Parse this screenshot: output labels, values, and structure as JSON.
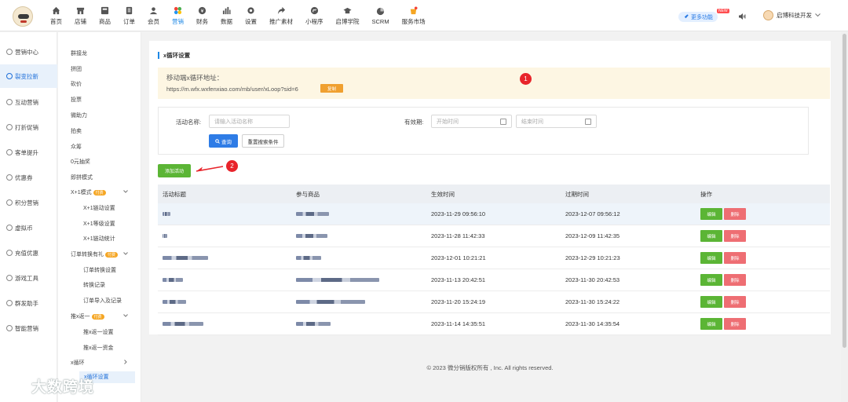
{
  "topnav": {
    "items": [
      {
        "label": "首页",
        "icon": "home-icon"
      },
      {
        "label": "店铺",
        "icon": "store-icon"
      },
      {
        "label": "商品",
        "icon": "goods-icon"
      },
      {
        "label": "订单",
        "icon": "order-icon"
      },
      {
        "label": "会员",
        "icon": "member-icon"
      },
      {
        "label": "营销",
        "icon": "marketing-icon"
      },
      {
        "label": "财务",
        "icon": "finance-icon"
      },
      {
        "label": "数据",
        "icon": "data-icon"
      },
      {
        "label": "设置",
        "icon": "settings-icon"
      },
      {
        "label": "推广素材",
        "icon": "share-icon"
      },
      {
        "label": "小程序",
        "icon": "miniprogram-icon"
      },
      {
        "label": "启博学院",
        "icon": "academy-icon"
      },
      {
        "label": "SCRM",
        "icon": "scrm-icon"
      },
      {
        "label": "服务市场",
        "icon": "market-icon"
      }
    ],
    "active_color": "#1e88e5",
    "more_label": "更多功能",
    "new_badge": "NEW",
    "user_name": "启博科技开发"
  },
  "sidebar": {
    "items": [
      {
        "label": "营销中心"
      },
      {
        "label": "裂变拉新"
      },
      {
        "label": "互动营销"
      },
      {
        "label": "打折促销"
      },
      {
        "label": "客单提升"
      },
      {
        "label": "优惠券"
      },
      {
        "label": "积分营销"
      },
      {
        "label": "虚拟币"
      },
      {
        "label": "充值优惠"
      },
      {
        "label": "游戏工具"
      },
      {
        "label": "群发助手"
      },
      {
        "label": "智能营销"
      }
    ]
  },
  "subnav": {
    "items": [
      {
        "label": "群接龙"
      },
      {
        "label": "拼团"
      },
      {
        "label": "砍价"
      },
      {
        "label": "投票"
      },
      {
        "label": "微助力"
      },
      {
        "label": "拍卖"
      },
      {
        "label": "众筹"
      },
      {
        "label": "0元抽奖"
      },
      {
        "label": "即拼模式"
      },
      {
        "label": "X+1模式",
        "tag": "付费"
      },
      {
        "label": "X+1链动设置"
      },
      {
        "label": "X+1等级设置"
      },
      {
        "label": "X+1链动统计"
      },
      {
        "label": "订单转换有礼",
        "tag": "付费"
      },
      {
        "label": "订单转换设置"
      },
      {
        "label": "转换记录"
      },
      {
        "label": "订单导入及记录"
      },
      {
        "label": "推x返一",
        "tag": "付费"
      },
      {
        "label": "推x返一设置"
      },
      {
        "label": "推x返一资金"
      },
      {
        "label": "x循环"
      },
      {
        "label": "x循环设置"
      }
    ]
  },
  "page": {
    "title": "x循环设置",
    "url_label": "移动端x循环地址：",
    "url": "https://m.wfx.wxfenxiao.com/mb/user/xLoop?sid=6",
    "copy_label": "复制",
    "marker1": "1",
    "marker2": "2"
  },
  "search": {
    "name_label": "活动名称:",
    "name_placeholder": "请输入活动名称",
    "valid_label": "有效期:",
    "start_placeholder": "开始时间",
    "end_placeholder": "结束时间",
    "query_label": "查询",
    "reset_label": "重置搜索条件"
  },
  "add_button": "添加活动",
  "table": {
    "headers": [
      "活动标题",
      "参与商品",
      "生效时间",
      "过期时间",
      "操作"
    ],
    "rows": [
      {
        "start": "2023-11-29 09:56:10",
        "end": "2023-12-07 09:56:12"
      },
      {
        "start": "2023-11-28 11:42:33",
        "end": "2023-12-09 11:42:35"
      },
      {
        "start": "2023-12-01 10:21:21",
        "end": "2023-12-29 10:21:23"
      },
      {
        "start": "2023-11-13 20:42:51",
        "end": "2023-11-30 20:42:53"
      },
      {
        "start": "2023-11-20 15:24:19",
        "end": "2023-11-30 15:24:22"
      },
      {
        "start": "2023-11-14 14:35:51",
        "end": "2023-11-30 14:35:54"
      }
    ],
    "edit_label": "编辑",
    "delete_label": "删除"
  },
  "footer": "© 2023 微分销版权所有 , Inc. All rights reserved.",
  "watermark": "大数跨境"
}
